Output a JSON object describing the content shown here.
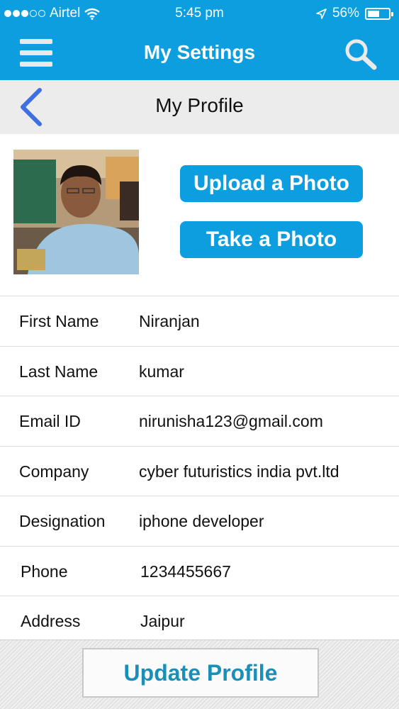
{
  "status_bar": {
    "carrier": "Airtel",
    "time": "5:45 pm",
    "battery": "56%",
    "battery_level": 0.56
  },
  "nav": {
    "title": "My Settings",
    "menu_icon": "hamburger-menu-icon",
    "search_icon": "search-icon"
  },
  "sub_header": {
    "title": "My Profile",
    "back_icon": "back-chevron-icon"
  },
  "photo": {
    "upload_label": "Upload a Photo",
    "take_label": "Take a Photo"
  },
  "fields": [
    {
      "label": "First Name",
      "value": "Niranjan"
    },
    {
      "label": "Last Name",
      "value": "kumar"
    },
    {
      "label": "Email ID",
      "value": "nirunisha123@gmail.com"
    },
    {
      "label": "Company",
      "value": "cyber futuristics india pvt.ltd"
    },
    {
      "label": "Designation",
      "value": "iphone developer"
    },
    {
      "label": "Phone",
      "value": "1234455667"
    },
    {
      "label": "Address",
      "value": "Jaipur"
    }
  ],
  "footer": {
    "update_label": "Update Profile"
  },
  "colors": {
    "accent": "#0d9ee0",
    "button_text": "#1a8fb8"
  }
}
